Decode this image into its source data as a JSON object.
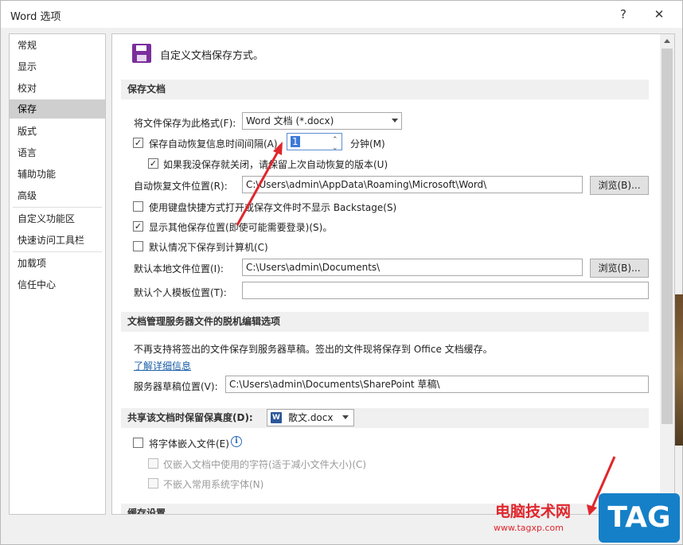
{
  "window": {
    "title": "Word 选项",
    "help": "?",
    "close": "✕"
  },
  "nav": {
    "items": [
      {
        "label": "常规"
      },
      {
        "label": "显示"
      },
      {
        "label": "校对"
      },
      {
        "label": "保存"
      },
      {
        "label": "版式"
      },
      {
        "label": "语言"
      },
      {
        "label": "辅助功能"
      },
      {
        "label": "高级"
      },
      {
        "label": "自定义功能区"
      },
      {
        "label": "快速访问工具栏"
      },
      {
        "label": "加载项"
      },
      {
        "label": "信任中心"
      }
    ],
    "active": "保存"
  },
  "content": {
    "heading": "自定义文档保存方式。",
    "save_section": {
      "title": "保存文档",
      "format_label": "将文件保存为此格式(F):",
      "format_value": "Word 文档 (*.docx)",
      "autorecover_label": "保存自动恢复信息时间间隔(A)",
      "autorecover_minutes": "1",
      "minutes_unit": "分钟(M)",
      "keep_last_label": "如果我没保存就关闭，请保留上次自动恢复的版本(U)",
      "autorecover_location_label": "自动恢复文件位置(R):",
      "autorecover_location_value": "C:\\Users\\admin\\AppData\\Roaming\\Microsoft\\Word\\",
      "browse_label": "浏览(B)...",
      "no_backstage_label": "使用键盘快捷方式打开或保存文件时不显示 Backstage(S)",
      "show_other_label": "显示其他保存位置(即使可能需要登录)(S)。",
      "default_computer_label": "默认情况下保存到计算机(C)",
      "default_local_label": "默认本地文件位置(I):",
      "default_local_value": "C:\\Users\\admin\\Documents\\",
      "browse2_label": "浏览(B)...",
      "personal_templates_label": "默认个人模板位置(T):",
      "personal_templates_value": ""
    },
    "offline_section": {
      "title": "文档管理服务器文件的脱机编辑选项",
      "notice": "不再支持将签出的文件保存到服务器草稿。签出的文件现将保存到 Office 文档缓存。",
      "learn_more": "了解详细信息",
      "drafts_label": "服务器草稿位置(V):",
      "drafts_value": "C:\\Users\\admin\\Documents\\SharePoint 草稿\\"
    },
    "fidelity_section": {
      "title": "共享该文档时保留保真度(D):",
      "document": "散文.docx",
      "embed_fonts_label": "将字体嵌入文件(E)",
      "embed_used_label": "仅嵌入文档中使用的字符(适于减小文件大小)(C)",
      "no_common_label": "不嵌入常用系统字体(N)"
    },
    "cache_section": {
      "title": "缓存设置"
    }
  },
  "checkboxes": {
    "autorecover": true,
    "keep_last": true,
    "no_backstage": false,
    "show_other": true,
    "default_computer": false,
    "embed_fonts": false,
    "embed_used": false,
    "no_common": false
  },
  "watermark": {
    "site": "电脑技术网",
    "url": "www.tagxp.com",
    "tag": "TAG"
  },
  "colors": {
    "save_icon": "#7a2f9c",
    "link": "#1a5ea6",
    "arrow": "#e0262c",
    "tag_bg": "#1580c8"
  }
}
